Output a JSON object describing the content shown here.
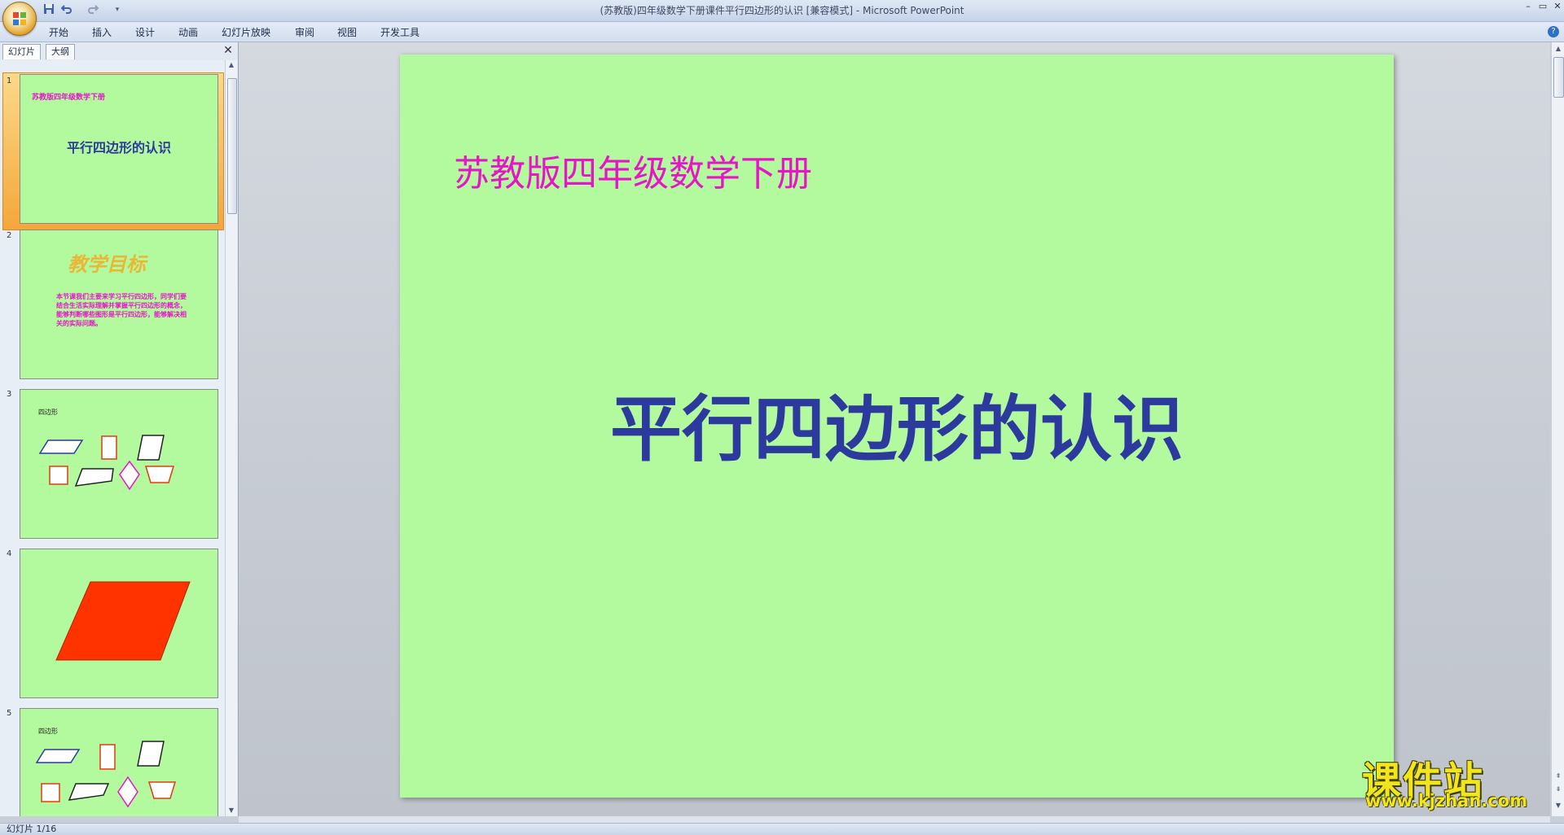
{
  "window": {
    "title": "(苏教版)四年级数学下册课件平行四边形的认识 [兼容模式] - Microsoft PowerPoint",
    "controls": {
      "minimize": "–",
      "restore": "▭",
      "close": "✕"
    }
  },
  "quick_access": {
    "save_icon": "save-icon",
    "undo_icon": "undo-icon",
    "redo_icon": "redo-icon",
    "customize": "▾"
  },
  "ribbon": {
    "tabs": [
      "开始",
      "插入",
      "设计",
      "动画",
      "幻灯片放映",
      "审阅",
      "视图",
      "开发工具"
    ],
    "help": "?"
  },
  "left_pane": {
    "tabs": [
      "幻灯片",
      "大纲"
    ],
    "close": "✕",
    "slides": [
      {
        "number": "1",
        "subtitle": "苏教版四年级数学下册",
        "title": "平行四边形的认识"
      },
      {
        "number": "2",
        "title": "教学目标",
        "body": "本节课我们主要来学习平行四边形，同学们要结合生活实际理解并掌握平行四边形的概念，能够判断哪些图形是平行四边形，能够解决相关的实际问题。"
      },
      {
        "number": "3",
        "label": "四边形"
      },
      {
        "number": "4"
      },
      {
        "number": "5",
        "label": "四边形"
      }
    ]
  },
  "slide": {
    "subtitle": "苏教版四年级数学下册",
    "title": "平行四边形的认识",
    "background": "#b3fa9f",
    "subtitle_color": "#e616c8",
    "title_color": "#2b3a9c"
  },
  "status": {
    "text": "幻灯片 1/16"
  },
  "watermark": {
    "title": "课件站",
    "url": "www.kjzhan.com"
  },
  "colors": {
    "accent_orange": "#f5a63a",
    "shape_red": "#ff3300",
    "shape_magenta": "#e616c8"
  }
}
